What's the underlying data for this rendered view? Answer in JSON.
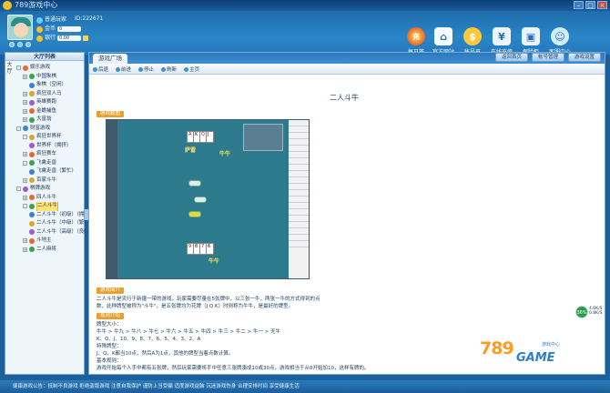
{
  "window": {
    "title": "789游戏中心"
  },
  "user": {
    "name": "普通玩家",
    "id_label": "ID:222671",
    "coin_label": "金币",
    "coin_value": "0",
    "bank_label": "银行",
    "bank_value": "0.00"
  },
  "topnav": [
    {
      "label": "每日签",
      "icon": "recharge-icon"
    },
    {
      "label": "官方网站",
      "icon": "home-icon"
    },
    {
      "label": "帐号充",
      "icon": "coin-icon"
    },
    {
      "label": "在线充值",
      "icon": "security-icon"
    },
    {
      "label": "保险柜",
      "icon": "lock-icon"
    },
    {
      "label": "客服中心",
      "icon": "service-icon"
    }
  ],
  "sidebar": {
    "title": "大厅列表",
    "tabs": [
      "大",
      "厅"
    ],
    "tree": [
      {
        "label": "娱乐游戏",
        "level": 0,
        "sign": "-"
      },
      {
        "label": "中国象棋",
        "level": 1,
        "sign": "+"
      },
      {
        "label": "象棋（空闲）",
        "level": 2,
        "sign": ""
      },
      {
        "label": "疯狂双人马",
        "level": 1,
        "sign": "+"
      },
      {
        "label": "英雄赛跑",
        "level": 1,
        "sign": "+"
      },
      {
        "label": "金蟾捕鱼",
        "level": 1,
        "sign": "+"
      },
      {
        "label": "大富翁",
        "level": 1,
        "sign": "+"
      },
      {
        "label": "财富游戏",
        "level": 0,
        "sign": "-"
      },
      {
        "label": "疯狂世界杯",
        "level": 1,
        "sign": "-"
      },
      {
        "label": "世界杯（拥挤）",
        "level": 2,
        "sign": ""
      },
      {
        "label": "疯狂赛车",
        "level": 1,
        "sign": "+"
      },
      {
        "label": "飞禽走兽",
        "level": 1,
        "sign": "-"
      },
      {
        "label": "飞禽走兽（繁忙）",
        "level": 2,
        "sign": ""
      },
      {
        "label": "百家斗牛",
        "level": 1,
        "sign": "+"
      },
      {
        "label": "棋牌游戏",
        "level": 0,
        "sign": "-"
      },
      {
        "label": "四人斗牛",
        "level": 1,
        "sign": "+"
      },
      {
        "label": "二人斗牛",
        "level": 1,
        "sign": "-",
        "selected": true
      },
      {
        "label": "二人斗牛（初级）（拥挤）",
        "level": 2,
        "sign": ""
      },
      {
        "label": "二人斗牛（中级）（繁忙）",
        "level": 2,
        "sign": ""
      },
      {
        "label": "二人斗牛（高级）（良好）",
        "level": 2,
        "sign": ""
      },
      {
        "label": "斗地主",
        "level": 1,
        "sign": "+"
      },
      {
        "label": "二人麻将",
        "level": 1,
        "sign": "+"
      }
    ]
  },
  "main": {
    "tab": "游戏广场",
    "top_buttons": [
      "返回首页",
      "帐号管理",
      "游戏设置"
    ],
    "toolbar": [
      "后退",
      "前进",
      "停止",
      "刷新",
      "主页"
    ],
    "game_title": "二人斗牛",
    "section_screenshot": "游戏截图",
    "section_intro": "游戏简介",
    "intro_text": "二人斗牛是流行于新疆一带的游戏，玩家需要尽量在5张牌中，以三张一牛，两张一牛的方式得到的点数，此种牌型被称为\"斗牛\"，是五张牌均为花牌（J Q K）时则称为牛牛，是最好的牌型。",
    "section_rules": "规则介绍",
    "rules": [
      "牌型大小：",
      "牛牛 > 牛九 > 牛八 > 牛七 > 牛六 > 牛五 > 牛四 > 牛三 > 牛二 > 牛一 > 无牛",
      "K、Q、J、10、9、8、7、6、5、4、3、2、A",
      "特殊牌型：",
      "J、Q、K都当10点，然后A为1点，其他的牌型当着点数计算。",
      "基本规则：",
      "游戏开始每个人手中都有五张牌，然后玩家需要将手中任意三张牌凑成10或30点，游戏相当于从0开始加10，这样有牌的。"
    ],
    "game_names": [
      "萨雷",
      "牛牛"
    ],
    "side_panel_label": "牛牛"
  },
  "net": {
    "percent": "36%",
    "down": "4.6K/S",
    "up": "0.8K/S"
  },
  "brand": {
    "number": "789",
    "word": "GAME",
    "sub": "游戏中心"
  },
  "status_text": "健康游戏公告：抵制不良游戏  拒绝盗版游戏  注意自我保护  谨防上当受骗  适度游戏益脑  沉迷游戏伤身  合理安排时间  享受健康生活",
  "colors": {
    "header": "#2478b9",
    "accent": "#e8a02a",
    "selected": "#ffe27a"
  }
}
